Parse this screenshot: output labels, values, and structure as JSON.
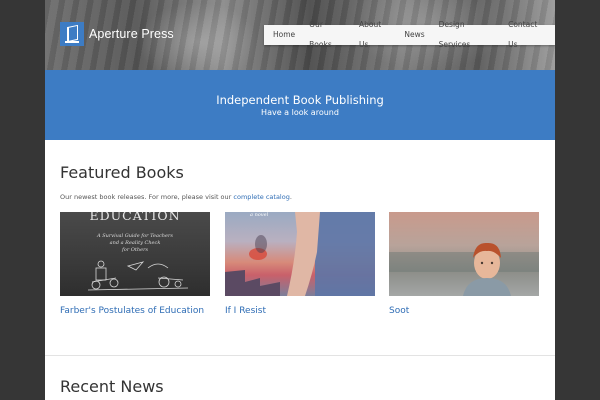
{
  "site": {
    "name": "Aperture Press"
  },
  "nav": {
    "items": [
      "Home",
      "Our Books",
      "About Us",
      "News",
      "Design Services",
      "Contact Us"
    ]
  },
  "banner": {
    "title": "Independent Book Publishing",
    "subtitle": "Have a look around"
  },
  "featured": {
    "heading": "Featured Books",
    "intro_text": "Our newest book releases. For more, please visit our",
    "intro_link": "complete catalog",
    "intro_end": ".",
    "books": [
      {
        "title": "Farber's Postulates of Education",
        "cover_heading": "EDUCATION",
        "cover_subtitle_1": "A Survival Guide for Teachers",
        "cover_subtitle_2": "and a Reality Check",
        "cover_subtitle_3": "for Others"
      },
      {
        "title": "If I Resist",
        "cover_caption": "a novel"
      },
      {
        "title": "Soot"
      }
    ]
  },
  "news": {
    "heading": "Recent News"
  },
  "colors": {
    "accent": "#3d7cc4",
    "link": "#2f6db5",
    "outer_background": "#363636"
  },
  "icons": {
    "logo": "book-logo-icon"
  }
}
